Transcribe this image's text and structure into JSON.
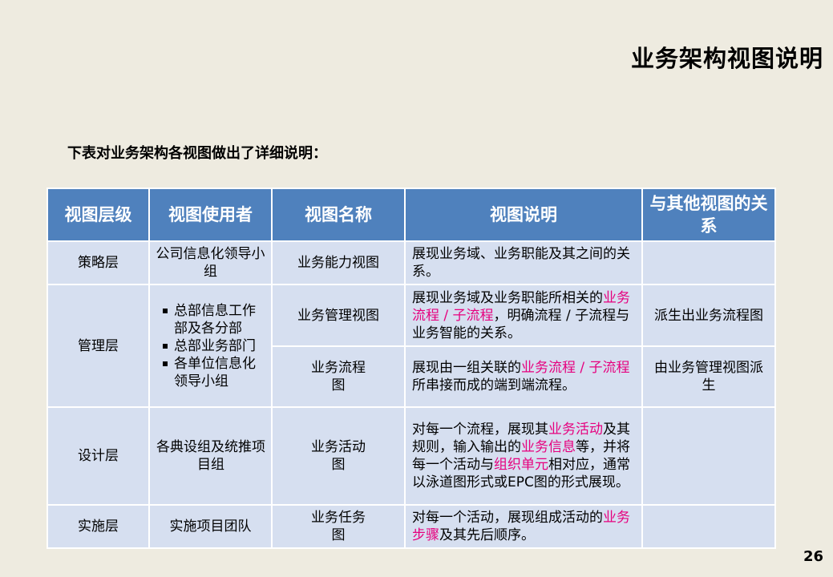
{
  "title": "业务架构视图说明",
  "intro": "下表对业务架构各视图做出了详细说明：",
  "page_number": "26",
  "table": {
    "headers": [
      "视图层级",
      "视图使用者",
      "视图名称",
      "视图说明",
      "与其他视图的关系"
    ],
    "rows": {
      "r0": {
        "level": "策略层",
        "users": "公司信息化领导小组",
        "name": "业务能力视图",
        "desc": "展现业务域、业务职能及其之间的关系。",
        "relation": ""
      },
      "r1": {
        "level": "管理层",
        "users_list": [
          "总部信息工作部及各分部",
          "总部业务部门",
          "各单位信息化领导小组"
        ],
        "name": "业务管理视图",
        "desc_a": "展现业务域及业务职能所相关的",
        "desc_b": "业务流程 / 子流程",
        "desc_c": "，明确流程 / 子流程与业务智能的关系。",
        "relation": "派生出业务流程图"
      },
      "r2": {
        "name": "业务流程图",
        "desc_a": "展现由一组关联的",
        "desc_b": "业务流程 / 子流程",
        "desc_c": "所串接而成的端到端流程。",
        "relation": "由业务管理视图派生"
      },
      "r3": {
        "level": "设计层",
        "users": "各典设组及统推项目组",
        "name": "业务活动图",
        "desc_a": "对每一个流程，展现其",
        "desc_b": "业务活动",
        "desc_c": "及其规则，输入输出的",
        "desc_d": "业务信息",
        "desc_e": "等，并将每一个活动与",
        "desc_f": "组织单元",
        "desc_g": "相对应，通常以泳道图形式或EPC图的形式展现。",
        "relation": ""
      },
      "r4": {
        "level": "实施层",
        "users": "实施项目团队",
        "name": "业务任务图",
        "desc_a": "对每一个活动，展现组成活动的",
        "desc_b": "业务步骤",
        "desc_c": "及其先后顺序。",
        "relation": ""
      }
    }
  },
  "colors": {
    "background": "#eeebe0",
    "header_fill": "#4f81bd",
    "cell_fill": "#d6dff0",
    "highlight_text": "#e6007e"
  }
}
